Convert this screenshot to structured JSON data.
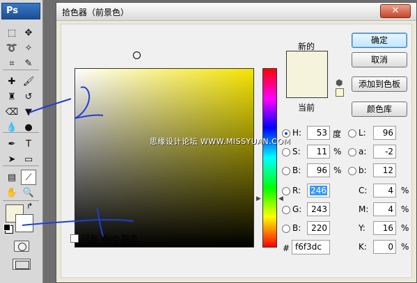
{
  "toolbox": {
    "logo": "Ps",
    "foreground_color": "#f6f3dc",
    "background_color": "#ffffff",
    "tools": [
      {
        "name": "marquee-tool-icon",
        "glyph": "⬚"
      },
      {
        "name": "move-tool-icon",
        "glyph": "✥"
      },
      {
        "name": "lasso-tool-icon",
        "glyph": "➰"
      },
      {
        "name": "magic-wand-icon",
        "glyph": "✧"
      },
      {
        "name": "crop-tool-icon",
        "glyph": "⌗"
      },
      {
        "name": "slice-tool-icon",
        "glyph": "✎"
      },
      {
        "name": "healing-brush-icon",
        "glyph": "✚"
      },
      {
        "name": "brush-tool-icon",
        "glyph": "🖌"
      },
      {
        "name": "stamp-tool-icon",
        "glyph": "♜"
      },
      {
        "name": "history-brush-icon",
        "glyph": "↺"
      },
      {
        "name": "eraser-tool-icon",
        "glyph": "⌫"
      },
      {
        "name": "paint-bucket-icon",
        "glyph": "▼"
      },
      {
        "name": "blur-tool-icon",
        "glyph": "💧"
      },
      {
        "name": "dodge-tool-icon",
        "glyph": "●"
      },
      {
        "name": "pen-tool-icon",
        "glyph": "✒"
      },
      {
        "name": "type-tool-icon",
        "glyph": "T"
      },
      {
        "name": "path-select-icon",
        "glyph": "➤"
      },
      {
        "name": "shape-tool-icon",
        "glyph": "▭"
      },
      {
        "name": "notes-tool-icon",
        "glyph": "▤"
      },
      {
        "name": "eyedropper-tool-icon",
        "glyph": "⟋"
      },
      {
        "name": "hand-tool-icon",
        "glyph": "✋"
      },
      {
        "name": "zoom-tool-icon",
        "glyph": "🔍"
      }
    ]
  },
  "dialog": {
    "title": "拾色器（前景色）",
    "close_label": "✕",
    "new_label": "新的",
    "current_label": "当前",
    "new_color": "#f6f3dc",
    "current_color": "#f6f3dc",
    "buttons": {
      "ok": "确定",
      "cancel": "取消",
      "add_to_swatches": "添加到色板",
      "color_libraries": "颜色库"
    },
    "web_only_label": "只有 Web 颜色",
    "hsb": {
      "h": {
        "label": "H:",
        "value": "53",
        "unit": "度"
      },
      "s": {
        "label": "S:",
        "value": "11",
        "unit": "%"
      },
      "b": {
        "label": "B:",
        "value": "96",
        "unit": "%"
      }
    },
    "rgb": {
      "r": {
        "label": "R:",
        "value": "246"
      },
      "g": {
        "label": "G:",
        "value": "243"
      },
      "b": {
        "label": "B:",
        "value": "220"
      }
    },
    "lab": {
      "l": {
        "label": "L:",
        "value": "96"
      },
      "a": {
        "label": "a:",
        "value": "-2"
      },
      "b": {
        "label": "b:",
        "value": "12"
      }
    },
    "cmyk": {
      "c": {
        "label": "C:",
        "value": "4",
        "unit": "%"
      },
      "m": {
        "label": "M:",
        "value": "4",
        "unit": "%"
      },
      "y": {
        "label": "Y:",
        "value": "16",
        "unit": "%"
      },
      "k": {
        "label": "K:",
        "value": "0",
        "unit": "%"
      }
    },
    "hex": {
      "label": "#",
      "value": "f6f3dc"
    }
  },
  "watermark": "思缘设计论坛 WWW.MISSYUAN.COM"
}
